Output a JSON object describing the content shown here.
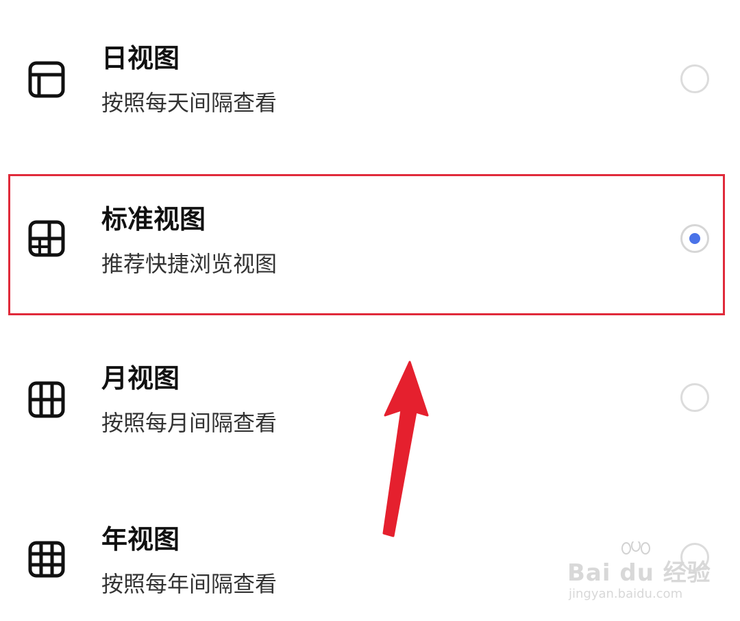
{
  "options": [
    {
      "title": "日视图",
      "desc": "按照每天间隔查看",
      "icon": "day-view-icon",
      "selected": false
    },
    {
      "title": "标准视图",
      "desc": "推荐快捷浏览视图",
      "icon": "standard-view-icon",
      "selected": true
    },
    {
      "title": "月视图",
      "desc": "按照每月间隔查看",
      "icon": "month-view-icon",
      "selected": false
    },
    {
      "title": "年视图",
      "desc": "按照每年间隔查看",
      "icon": "year-view-icon",
      "selected": false
    }
  ],
  "colors": {
    "accent": "#4a73e8",
    "highlight": "#e02a3a",
    "arrow": "#e5202e"
  },
  "watermark": {
    "logo": "Bai du 经验",
    "url": "jingyan.baidu.com"
  }
}
